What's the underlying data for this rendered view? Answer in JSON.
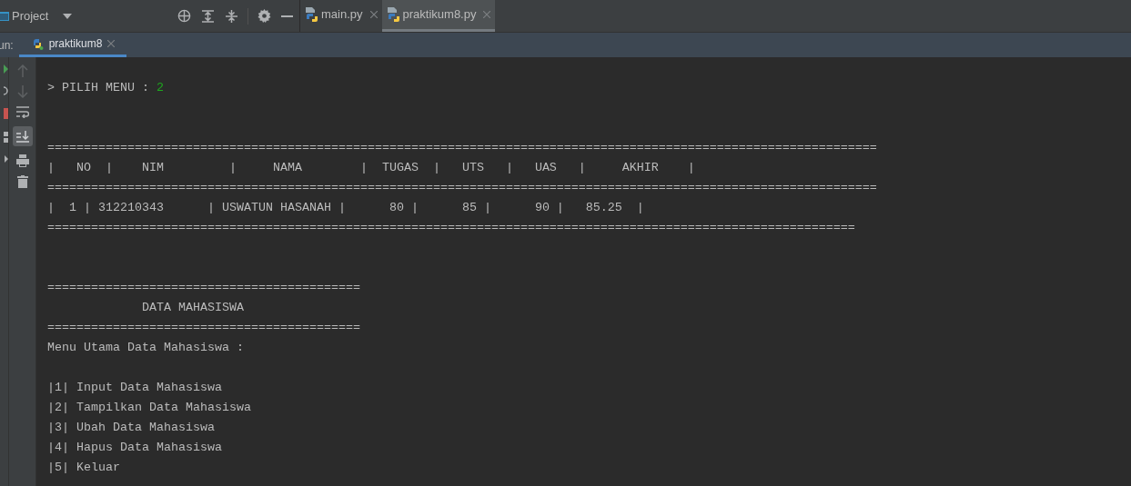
{
  "toolbar": {
    "project_label": "Project"
  },
  "editor_tabs": [
    {
      "label": "main.py",
      "selected": false
    },
    {
      "label": "praktikum8.py",
      "selected": true
    }
  ],
  "run_panel": {
    "label": "un:",
    "tabs": [
      {
        "label": "praktikum8",
        "selected": true
      }
    ]
  },
  "console": [
    {
      "kind": "prompt",
      "text": "> PILIH MENU : ",
      "input": "2"
    },
    {
      "kind": "blank"
    },
    {
      "kind": "blank"
    },
    {
      "kind": "output",
      "text": "=================================================================================================================="
    },
    {
      "kind": "output",
      "text": "|   NO  |    NIM         |     NAMA        |  TUGAS  |   UTS   |   UAS   |     AKHIR    |"
    },
    {
      "kind": "output",
      "text": "=================================================================================================================="
    },
    {
      "kind": "output",
      "text": "|  1 | 312210343      | USWATUN HASANAH |      80 |      85 |      90 |   85.25  |"
    },
    {
      "kind": "output",
      "text": "==============================================================================================================="
    },
    {
      "kind": "blank"
    },
    {
      "kind": "blank"
    },
    {
      "kind": "output",
      "text": "==========================================="
    },
    {
      "kind": "output",
      "text": "             DATA MAHASISWA"
    },
    {
      "kind": "output",
      "text": "==========================================="
    },
    {
      "kind": "output",
      "text": "Menu Utama Data Mahasiswa :"
    },
    {
      "kind": "blank"
    },
    {
      "kind": "output",
      "text": "|1| Input Data Mahasiswa"
    },
    {
      "kind": "output",
      "text": "|2| Tampilkan Data Mahasiswa"
    },
    {
      "kind": "output",
      "text": "|3| Ubah Data Mahasiswa"
    },
    {
      "kind": "output",
      "text": "|4| Hapus Data Mahasiswa"
    },
    {
      "kind": "output",
      "text": "|5| Keluar"
    }
  ]
}
